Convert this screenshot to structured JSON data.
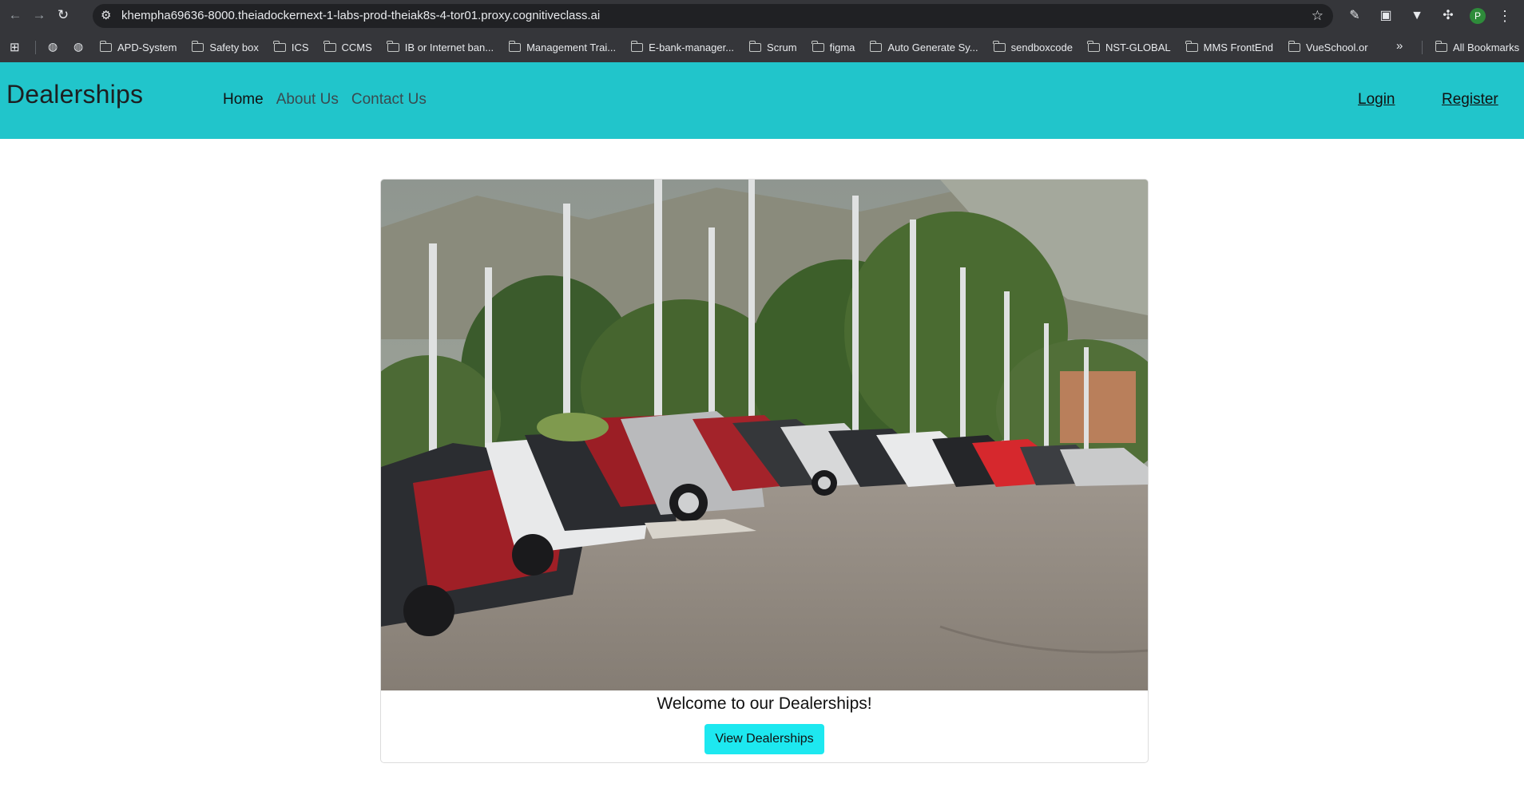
{
  "browser": {
    "url": "khempha69636-8000.theiadockernext-1-labs-prod-theiak8s-4-tor01.proxy.cognitiveclass.ai",
    "profile_initial": "P",
    "bookmarks": [
      "APD-System",
      "Safety box",
      "ICS",
      "CCMS",
      "IB or Internet ban...",
      "Management Trai...",
      "E-bank-manager...",
      "Scrum",
      "figma",
      "Auto Generate Sy...",
      "sendboxcode",
      "NST-GLOBAL",
      "MMS FrontEnd",
      "VueSchool.or"
    ],
    "all_bookmarks": "All Bookmarks",
    "more": "»"
  },
  "site": {
    "brand": "Dealerships",
    "nav": {
      "home": "Home",
      "about": "About Us",
      "contact": "Contact Us"
    },
    "auth": {
      "login": "Login",
      "register": "Register"
    }
  },
  "card": {
    "welcome": "Welcome to our Dealerships!",
    "button": "View Dealerships"
  },
  "colors": {
    "navbar": "#21c5cb",
    "button": "#1de8f0",
    "chrome": "#35363a"
  }
}
